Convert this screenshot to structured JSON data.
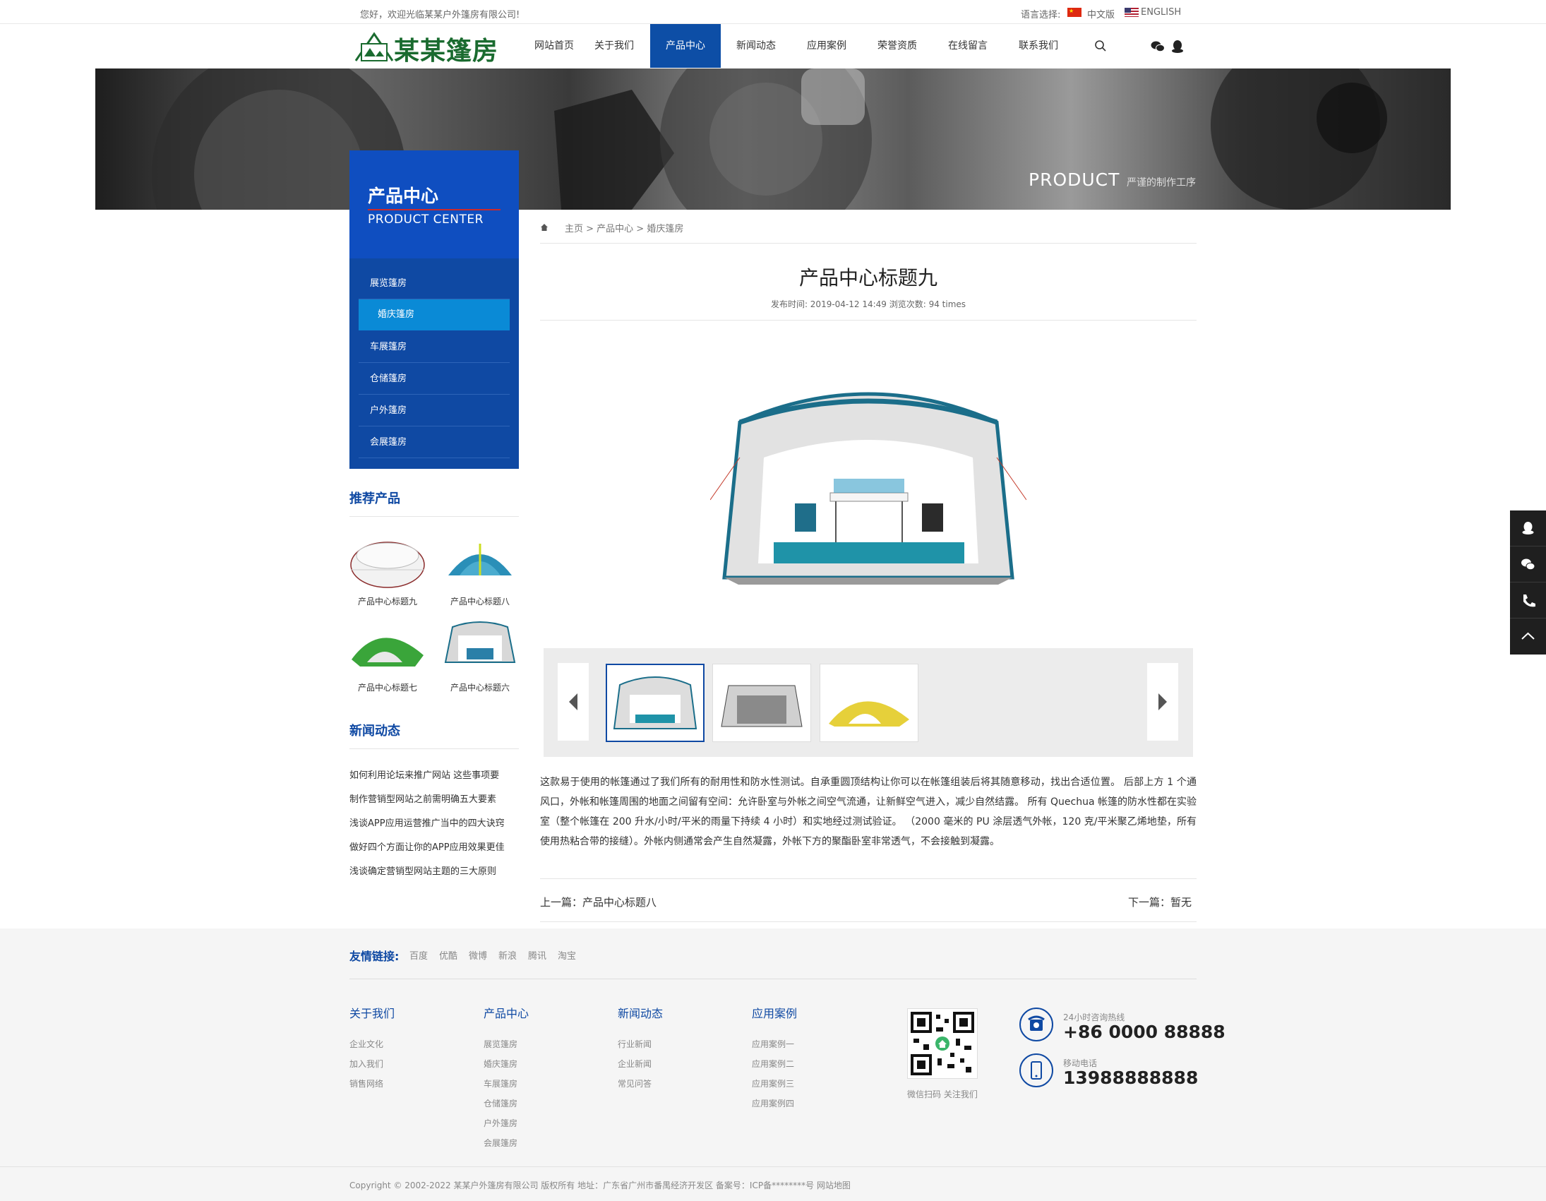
{
  "topbar": {
    "welcome": "您好，欢迎光临某某户外篷房有限公司!",
    "lang_label": "语言选择:",
    "lang_cn": "中文版",
    "lang_en": "ENGLISH"
  },
  "header": {
    "logo_text": "某某篷房",
    "nav": [
      "网站首页",
      "关于我们",
      "产品中心",
      "新闻动态",
      "应用案例",
      "荣誉资质",
      "在线留言",
      "联系我们"
    ],
    "active_nav": 2
  },
  "banner": {
    "title": "PRODUCT",
    "subtitle": "严谨的制作工序"
  },
  "sidebar": {
    "title": "产品中心",
    "subtitle": "PRODUCT CENTER",
    "items": [
      "展览篷房",
      "婚庆篷房",
      "车展篷房",
      "仓储篷房",
      "户外篷房",
      "会展篷房"
    ],
    "active_item": 1,
    "recommend_title": "推荐产品",
    "recommend": [
      "产品中心标题九",
      "产品中心标题八",
      "产品中心标题七",
      "产品中心标题六"
    ],
    "news_title": "新闻动态",
    "news": [
      "如何利用论坛来推广网站 这些事项要",
      "制作营销型网站之前需明确五大要素",
      "浅谈APP应用运营推广当中的四大诀窍",
      "做好四个方面让你的APP应用效果更佳",
      "浅谈确定营销型网站主题的三大原则"
    ]
  },
  "article": {
    "breadcrumb": "主页 > 产品中心 > 婚庆篷房",
    "title": "产品中心标题九",
    "meta": "发布时间: 2019-04-12 14:49  浏览次数: 94 times",
    "description": "这款易于使用的帐篷通过了我们所有的耐用性和防水性测试。自承重圆顶结构让你可以在帐篷组装后将其随意移动，找出合适位置。 后部上方 1 个通风口，外帐和帐篷周围的地面之间留有空间：允许卧室与外帐之间空气流通，让新鲜空气进入，减少自然结露。 所有 Quechua 帐篷的防水性都在实验室（整个帐篷在 200 升水/小时/平米的雨量下持续 4 小时）和实地经过测试验证。 （2000 毫米的 PU 涂层透气外帐，120 克/平米聚乙烯地垫，所有使用热粘合带的接缝）。外帐内侧通常会产生自然凝露，外帐下方的聚酯卧室非常透气，不会接触到凝露。",
    "prev": "上一篇：产品中心标题八",
    "next": "下一篇：暂无"
  },
  "footer": {
    "links_label": "友情链接:",
    "links": [
      "百度",
      "优酷",
      "微博",
      "新浪",
      "腾讯",
      "淘宝"
    ],
    "columns": [
      {
        "title": "关于我们",
        "items": [
          "企业文化",
          "加入我们",
          "销售网络"
        ]
      },
      {
        "title": "产品中心",
        "items": [
          "展览篷房",
          "婚庆篷房",
          "车展篷房",
          "仓储篷房",
          "户外篷房",
          "会展篷房"
        ]
      },
      {
        "title": "新闻动态",
        "items": [
          "行业新闻",
          "企业新闻",
          "常见问答"
        ]
      },
      {
        "title": "应用案例",
        "items": [
          "应用案例一",
          "应用案例二",
          "应用案例三",
          "应用案例四"
        ]
      }
    ],
    "qr_caption": "微信扫码 关注我们",
    "hotline_label": "24小时咨询热线",
    "hotline": "+86 0000 88888",
    "mobile_label": "移动电话",
    "mobile": "13988888888",
    "copyright": "Copyright © 2002-2022 某某户外篷房有限公司 版权所有    地址：广东省广州市番禺经济开发区    备案号：ICP备********号    网站地图"
  },
  "colors": {
    "primary": "#0f49a3",
    "accent_red": "#cc2a2a",
    "active_sub": "#0a8ad6",
    "logo_green": "#1a6b2f"
  }
}
